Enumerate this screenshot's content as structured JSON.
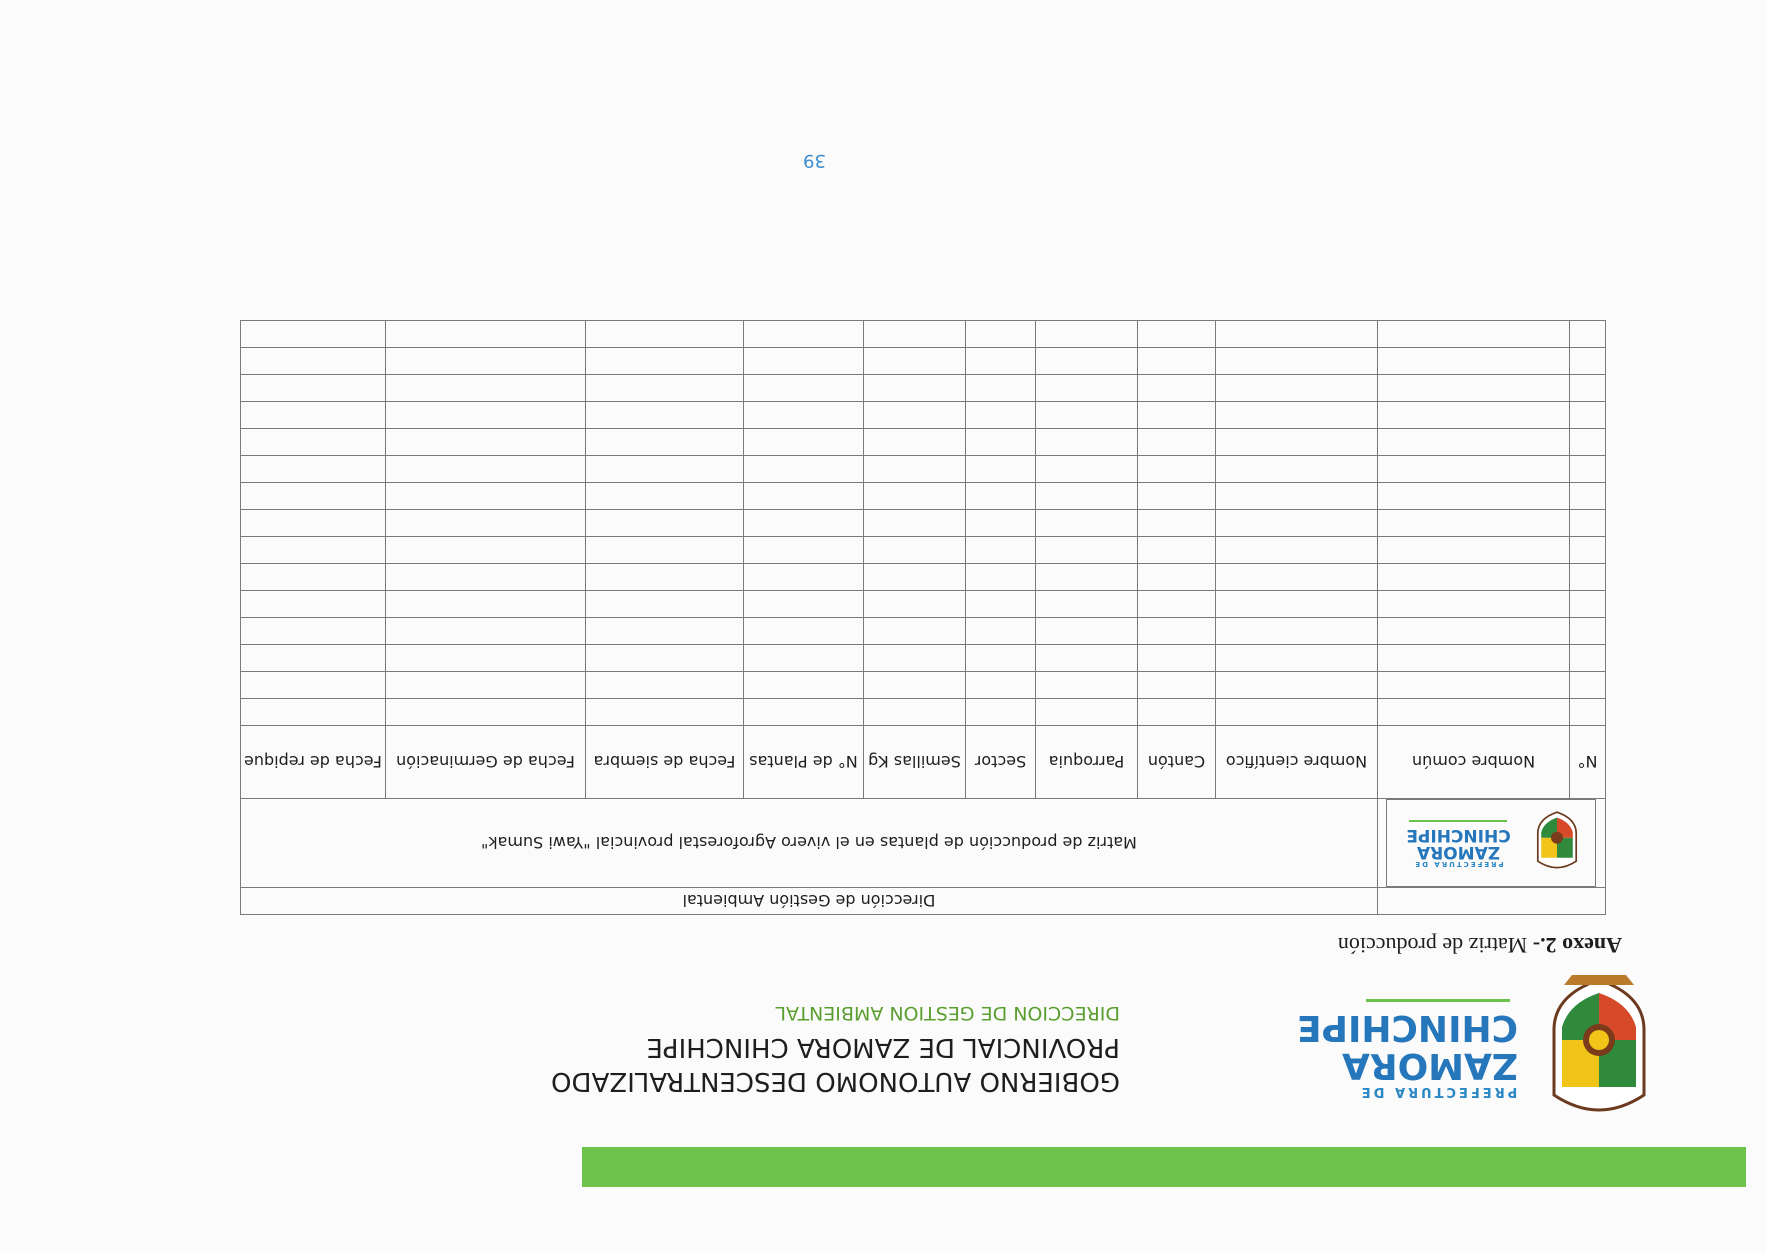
{
  "header": {
    "logo": {
      "prefix": "PREFECTURA DE",
      "line1": "ZAMORA",
      "line2": "CHINCHIPE"
    },
    "title_line1": "GOBIERNO AUTONOMO DESCENTRALIZADO",
    "title_line2": "PROVINCIAL DE ZAMORA CHINCHIPE",
    "subtitle": "DIRECCION DE GESTION AMBIENTAL",
    "colors": {
      "green_bar": "#6cc24a",
      "brand_blue": "#2576bb",
      "subtitle_green": "#5a9e2f"
    }
  },
  "annex": {
    "label": "Anexo 2.-",
    "text": " Matriz de producción"
  },
  "matrix": {
    "direction": "Dirección de Gestión Ambiental",
    "title": "Matriz de producción de plantas en el vivero Agroforestal provincial \"Yawi Sumak\"",
    "logo": {
      "prefix": "PREFECTURA DE",
      "line1": "ZAMORA",
      "line2": "CHINCHIPE"
    },
    "columns": [
      "N°",
      "Nombre común",
      "Nombre científico",
      "Cantón",
      "Parroquia",
      "Sector",
      "Semillas Kg",
      "N° de Plantas",
      "Fecha de siembra",
      "Fecha de Germinación",
      "Fecha de repique"
    ],
    "empty_rows": 15
  },
  "page_number": "39"
}
